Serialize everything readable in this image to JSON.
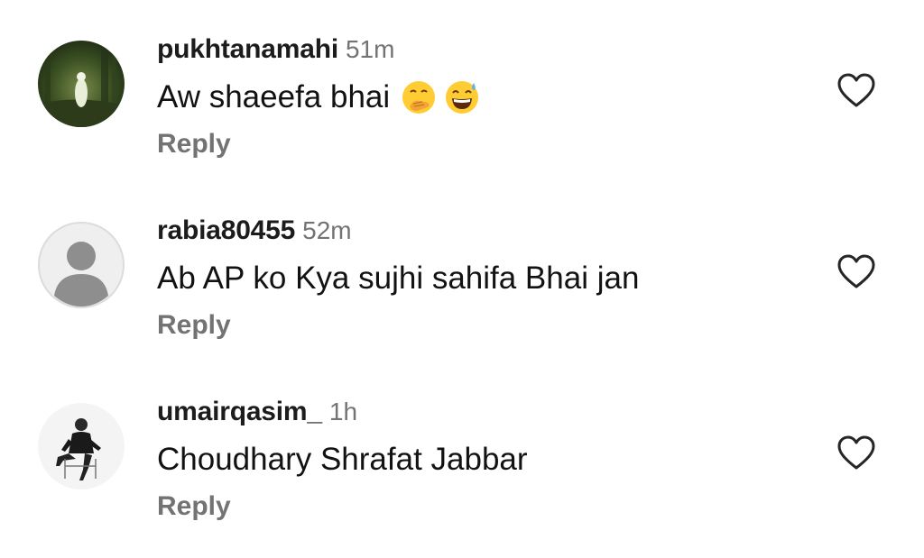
{
  "comments": [
    {
      "username": "pukhtanamahi",
      "time": "51m",
      "text": "Aw shaeefa bhai",
      "emojis": [
        "hand-over-mouth-emoji",
        "grinning-sweat-emoji"
      ],
      "reply_label": "Reply",
      "avatar": "forest-photo-avatar"
    },
    {
      "username": "rabia80455",
      "time": "52m",
      "text": "Ab AP ko Kya sujhi sahifa Bhai jan",
      "reply_label": "Reply",
      "avatar": "default-profile-avatar"
    },
    {
      "username": "umairqasim_",
      "time": "1h",
      "text": "Choudhary Shrafat Jabbar",
      "reply_label": "Reply",
      "avatar": "seated-man-photo-avatar"
    }
  ],
  "icons": {
    "like": "heart-outline-icon"
  },
  "colors": {
    "username": "#1c1c1c",
    "meta": "#737373",
    "text": "#121212"
  }
}
